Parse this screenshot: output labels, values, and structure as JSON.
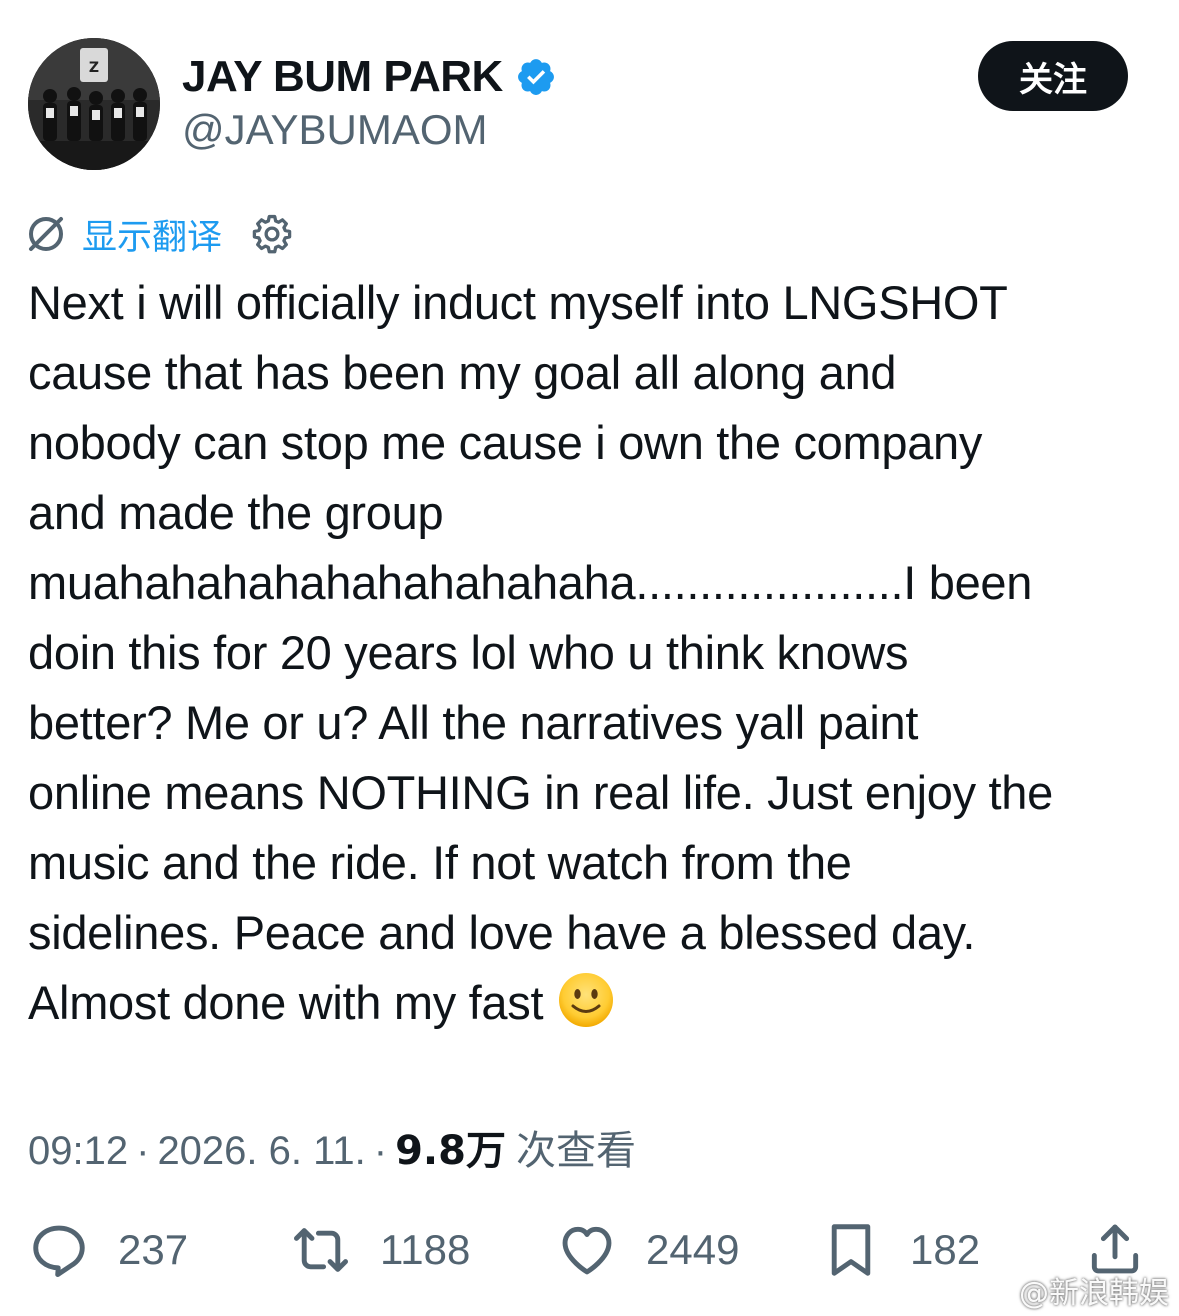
{
  "author": {
    "display_name": "JAY BUM PARK",
    "handle": "@JAYBUMAOM",
    "verified": true,
    "avatar_icon": "group-photo-avatar"
  },
  "follow_button": {
    "label": "关注"
  },
  "translate": {
    "icon": "translate-icon",
    "label": "显示翻译",
    "settings_icon": "gear-icon"
  },
  "tweet": {
    "lines": [
      "Next i will officially induct myself into LNGSHOT",
      "cause that has been my goal all along and",
      "nobody can stop me cause i own the company",
      "and made the group",
      "muahahahahahahahahahaha.....................I been",
      "doin this for 20 years lol who u think knows",
      "better? Me or u? All the narratives yall paint",
      "online means NOTHING in real life. Just enjoy the",
      "music and the ride. If not watch from the",
      "sidelines. Peace and love have a blessed day.",
      "Almost done with my fast"
    ],
    "emoji": "slightly-smiling-face-icon"
  },
  "meta": {
    "time": "09:12",
    "separator": "·",
    "date": "2026. 6. 11.",
    "views_count": "9.8万",
    "views_label": "次查看"
  },
  "actions": {
    "replies": "237",
    "reposts": "1188",
    "likes": "2449",
    "bookmarks": "182"
  },
  "watermark": {
    "text": "@新浪韩娱",
    "logo": "weibo-logo-icon"
  },
  "colors": {
    "text": "#0f1419",
    "secondary": "#536471",
    "link": "#1d9bf0",
    "verified": "#1d9bf0",
    "follow_bg": "#0f1419"
  }
}
